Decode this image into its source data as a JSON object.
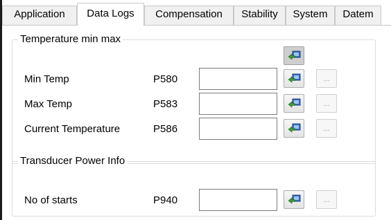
{
  "tabs": [
    {
      "label": "Application",
      "active": false
    },
    {
      "label": "Data Logs",
      "active": true
    },
    {
      "label": "Compensation",
      "active": false
    },
    {
      "label": "Stability",
      "active": false
    },
    {
      "label": "System",
      "active": false
    },
    {
      "label": "Datem",
      "active": false
    }
  ],
  "temperature_group": {
    "title": "Temperature min max",
    "rows": [
      {
        "label": "Min Temp",
        "code": "P580",
        "value": "",
        "more_label": "..."
      },
      {
        "label": "Max Temp",
        "code": "P583",
        "value": "",
        "more_label": "..."
      },
      {
        "label": "Current Temperature",
        "code": "P586",
        "value": "",
        "more_label": "..."
      }
    ]
  },
  "transducer_group": {
    "title": "Transducer Power Info",
    "rows": [
      {
        "label": "No of starts",
        "code": "P940",
        "value": "",
        "more_label": "..."
      }
    ]
  },
  "icons": {
    "transfer": "monitor-arrow-icon"
  },
  "colors": {
    "tab_border": "#c8c8c8",
    "icon_arrow": "#3a9a3a",
    "icon_screen": "#3a6fc4"
  }
}
